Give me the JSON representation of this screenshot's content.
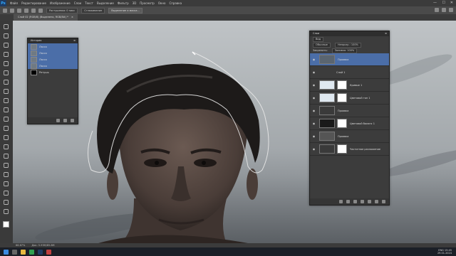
{
  "app": {
    "logo": "Ps",
    "accent": "#31a8ff",
    "selection_color": "#4b6ea8"
  },
  "menu": [
    "Файл",
    "Редактирование",
    "Изображение",
    "Слои",
    "Текст",
    "Выделение",
    "Фильтр",
    "3D",
    "Просмотр",
    "Окно",
    "Справка"
  ],
  "window_controls": {
    "minimize": "—",
    "maximize": "☐",
    "close": "✕"
  },
  "options_bar": {
    "feather": "Растушевка: 0 пикс",
    "antialias": "Сглаживание",
    "select_button": "Выделение и маска..."
  },
  "document_tab": {
    "title": "Слой 02 (RGB/8) (Выделено, RGB/8#) *",
    "close": "×"
  },
  "tools": [
    "move-tool",
    "marquee-tool",
    "lasso-tool",
    "quick-select-tool",
    "crop-tool",
    "eyedropper-tool",
    "healing-brush-tool",
    "brush-tool",
    "clone-stamp-tool",
    "history-brush-tool",
    "eraser-tool",
    "gradient-tool",
    "blur-tool",
    "dodge-tool",
    "pen-tool",
    "type-tool",
    "path-select-tool",
    "rectangle-tool",
    "hand-tool",
    "zoom-tool",
    "more-tools"
  ],
  "history_panel": {
    "title": "История",
    "rows": [
      {
        "label": "Лассо",
        "selected": true
      },
      {
        "label": "Лассо",
        "selected": true
      },
      {
        "label": "Лассо",
        "selected": true
      },
      {
        "label": "Лассо",
        "selected": true
      },
      {
        "label": "Ретушь",
        "selected": false
      }
    ]
  },
  "layers_panel": {
    "title": "Слои",
    "filter": "Вид",
    "blend_mode": "Обычные",
    "opacity": "Непрозр.: 100%",
    "lock": "Закрепить:",
    "fill": "Заливка: 100%",
    "layers": [
      {
        "name": "Проявка",
        "selected": true,
        "thumb": "photo",
        "mask": false
      },
      {
        "name": "Слой 1",
        "selected": false,
        "thumb": "none",
        "mask": false
      },
      {
        "name": "Кривые 1",
        "selected": false,
        "thumb": "light",
        "mask": true
      },
      {
        "name": "Цветовой тон 1",
        "selected": false,
        "thumb": "light",
        "mask": true
      },
      {
        "name": "Проявка",
        "selected": false,
        "thumb": "portrait",
        "mask": false
      },
      {
        "name": "Цветовой баланс 1",
        "selected": false,
        "thumb": "dark",
        "mask": true
      },
      {
        "name": "Проявка",
        "selected": false,
        "thumb": "group",
        "mask": false
      },
      {
        "name": "Частотное разложение",
        "selected": false,
        "thumb": "portrait",
        "mask": true
      }
    ]
  },
  "status": {
    "zoom": "66.67%",
    "doc_info": "Док: 5.93M/85.8M"
  },
  "taskbar": {
    "time": "15:45",
    "date": "29.01.2024",
    "lang": "ENG"
  }
}
